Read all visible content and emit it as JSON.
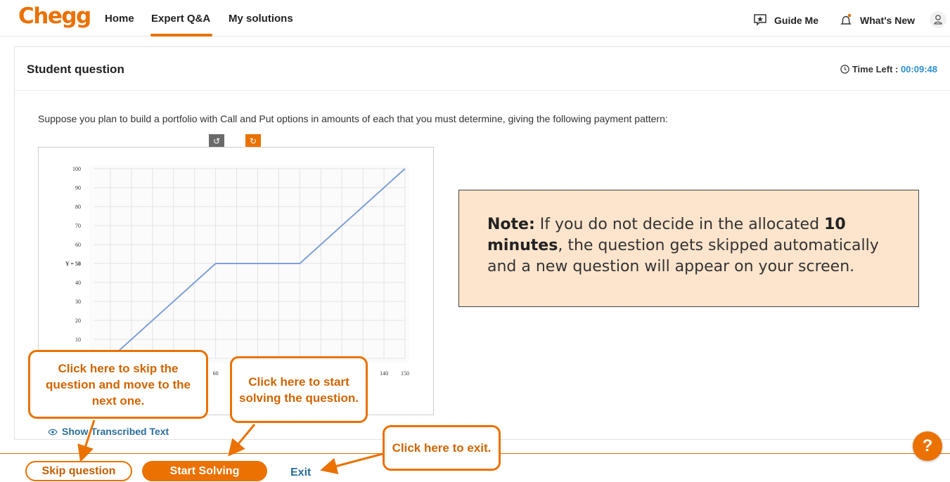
{
  "header": {
    "logo": "Chegg",
    "nav": [
      "Home",
      "Expert Q&A",
      "My solutions"
    ],
    "guide_me": "Guide Me",
    "whats_new": "What's New"
  },
  "card": {
    "title": "Student question",
    "time_label": "Time Left : ",
    "time_value": "00:09:48",
    "question": "Suppose you plan to build a portfolio with Call and Put options in amounts of each that you must determine, giving the following payment pattern:",
    "show_transcribed": "Show Transcribed Text"
  },
  "note": {
    "label": "Note:",
    "text1": " If you do not decide in the allocated ",
    "bold1": "10 minutes",
    "text2": ", the question gets skipped automatically and a new question will appear on your screen."
  },
  "buttons": {
    "skip": "Skip question",
    "start": "Start Solving",
    "exit": "Exit",
    "help": "?"
  },
  "callouts": {
    "skip": "Click here to skip the question and move to the next one.",
    "start": "Click here to start solving the question.",
    "exit": "Click here to exit."
  },
  "icons": {
    "rotate_left": "rotate-left-icon",
    "rotate_right": "rotate-right-icon",
    "clock": "clock-icon",
    "eye": "eye-icon",
    "star_chat": "guide-star-icon",
    "bell": "bell-icon",
    "user": "user-icon"
  },
  "colors": {
    "brand": "#eb7100",
    "link": "#2a6f9b",
    "timer": "#2b8fd1",
    "note_bg": "#fde4cc",
    "line": "#7f9fd6"
  },
  "chart_data": {
    "type": "line",
    "x": [
      10,
      60,
      100,
      150
    ],
    "series": [
      {
        "values": [
          0,
          50,
          50,
          100
        ]
      }
    ],
    "xlim": [
      10,
      150
    ],
    "ylim": [
      0,
      100
    ],
    "yticks": [
      10,
      20,
      30,
      40,
      50,
      60,
      70,
      80,
      90,
      100
    ],
    "xticks_visible": [
      60,
      140,
      150
    ],
    "ylabel_tick": "Y = 50",
    "grid": true
  }
}
